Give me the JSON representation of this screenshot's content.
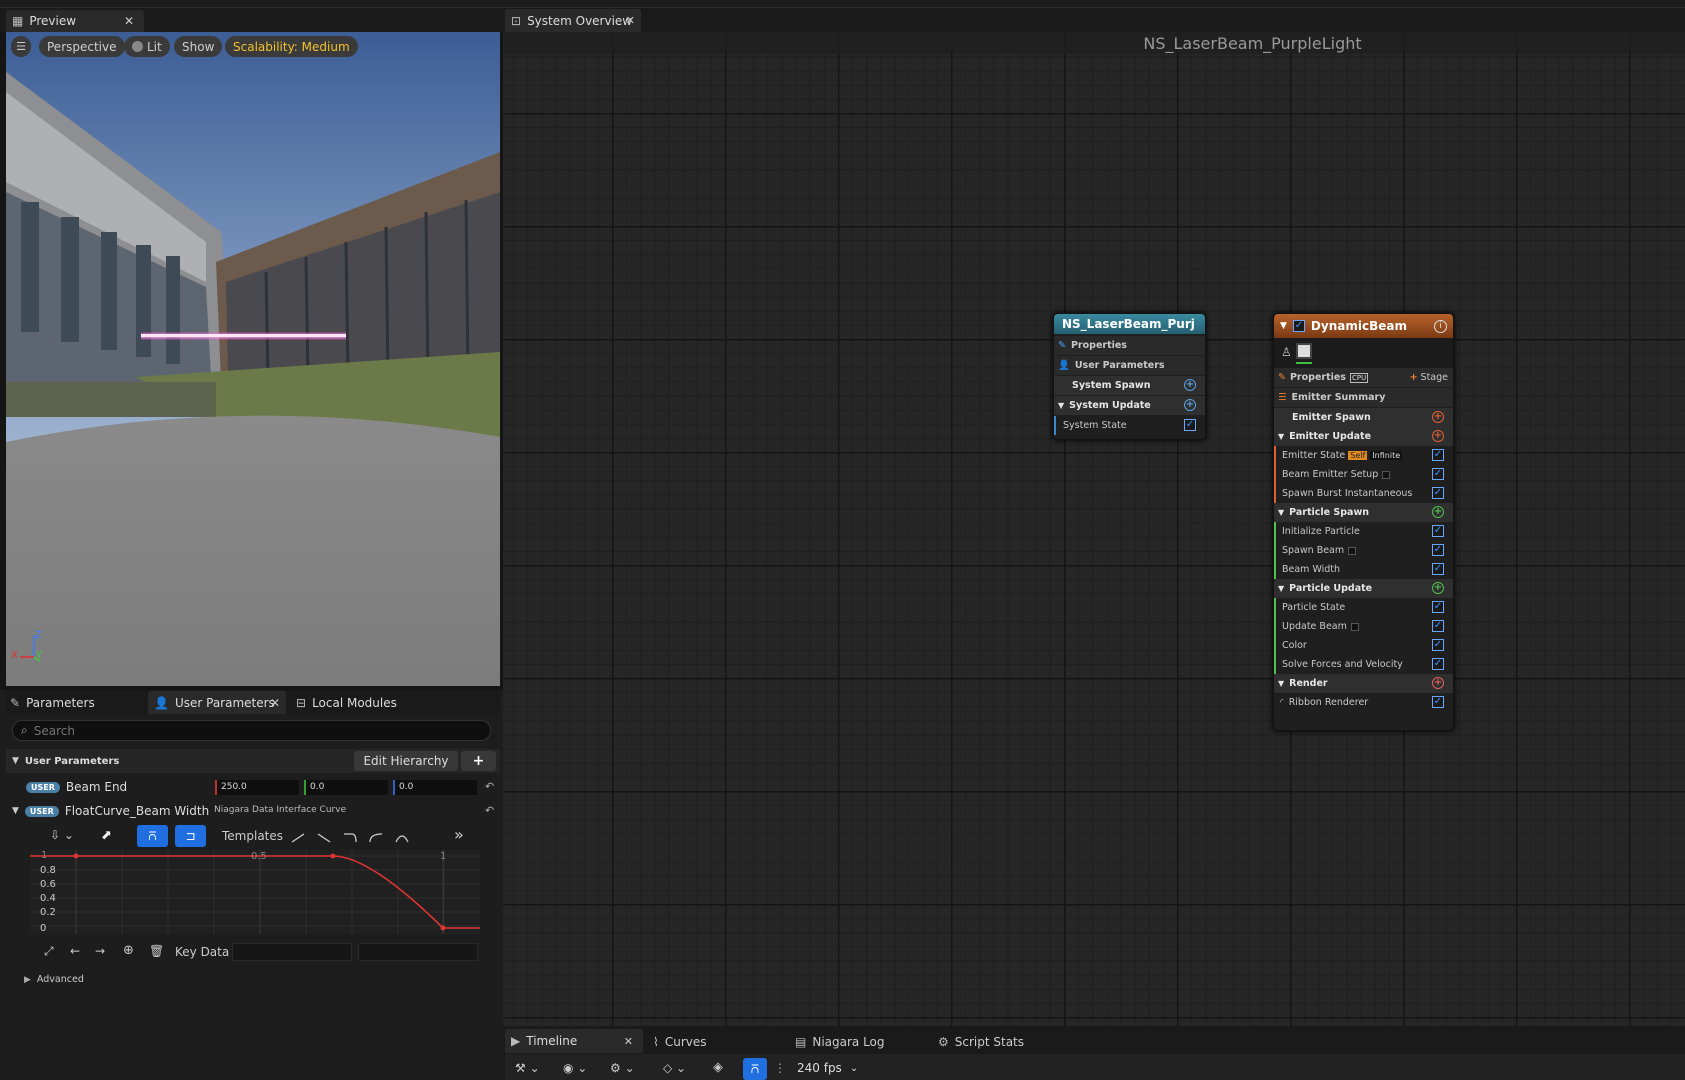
{
  "preview_tab": {
    "title": "Preview"
  },
  "viewport": {
    "pills": {
      "perspective": "Perspective",
      "lit": "Lit",
      "show": "Show",
      "scalability": "Scalability: Medium"
    },
    "axis": {
      "z": "Z",
      "x": "X",
      "y": "Y"
    }
  },
  "system_tab": {
    "title": "System Overview"
  },
  "graph_title": "NS_LaserBeam_PurpleLight",
  "params_panel": {
    "tabs": {
      "parameters": "Parameters",
      "user_parameters": "User Parameters",
      "local_modules": "Local Modules"
    },
    "search_placeholder": "Search",
    "section_label": "User Parameters",
    "edit_hierarchy": "Edit Hierarchy",
    "add": "+",
    "user_badge": "USER",
    "beam_end": {
      "label": "Beam End",
      "x": "250.0",
      "y": "0.0",
      "z": "0.0"
    },
    "float_curve": {
      "label": "FloatCurve_Beam Width",
      "type": "Niagara Data Interface Curve"
    },
    "templates_label": "Templates",
    "curve_labels": {
      "x0": "1",
      "x05": "0.5",
      "x1": "1",
      "y08": "0.8",
      "y06": "0.6",
      "y04": "0.4",
      "y02": "0.2",
      "y0": "0"
    },
    "key_data_label": "Key Data",
    "advanced": "Advanced"
  },
  "system_node": {
    "title": "NS_LaserBeam_Purj",
    "rows": {
      "properties": "Properties",
      "user_parameters": "User Parameters",
      "system_spawn": "System Spawn",
      "system_update": "System Update",
      "system_state": "System State"
    }
  },
  "emitter_node": {
    "title": "DynamicBeam",
    "properties": "Properties",
    "cpu": "CPU",
    "stage": "Stage",
    "emitter_summary": "Emitter Summary",
    "emitter_spawn": "Emitter Spawn",
    "emitter_update": "Emitter Update",
    "emitter_state": "Emitter State",
    "self_badge": "Self",
    "infinite_badge": "Infinite",
    "beam_emitter_setup": "Beam Emitter Setup",
    "spawn_burst": "Spawn Burst Instantaneous",
    "particle_spawn": "Particle Spawn",
    "initialize_particle": "Initialize Particle",
    "spawn_beam": "Spawn Beam",
    "beam_width": "Beam Width",
    "particle_update": "Particle Update",
    "particle_state": "Particle State",
    "update_beam": "Update Beam",
    "color": "Color",
    "solve_forces": "Solve Forces and Velocity",
    "render": "Render",
    "ribbon_renderer": "Ribbon Renderer"
  },
  "bottom_tabs": {
    "timeline": "Timeline",
    "curves": "Curves",
    "niagara_log": "Niagara Log",
    "script_stats": "Script Stats"
  },
  "fps": "240 fps"
}
